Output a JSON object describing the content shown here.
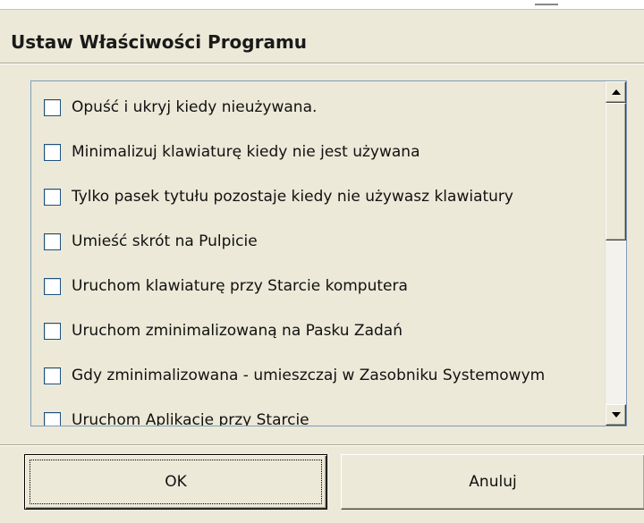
{
  "dialog": {
    "title": "Ustaw Właściwości Programu",
    "options": [
      {
        "label": "Opuść i ukryj kiedy nieużywana.",
        "checked": false
      },
      {
        "label": "Minimalizuj klawiaturę kiedy nie jest używana",
        "checked": false
      },
      {
        "label": "Tylko pasek tytułu pozostaje kiedy nie używasz klawiatury",
        "checked": false
      },
      {
        "label": "Umieść skrót na Pulpicie",
        "checked": false
      },
      {
        "label": "Uruchom klawiaturę przy Starcie komputera",
        "checked": false
      },
      {
        "label": "Uruchom zminimalizowaną na Pasku Zadań",
        "checked": false
      },
      {
        "label": "Gdy zminimalizowana - umieszczaj w Zasobniku Systemowym",
        "checked": false
      },
      {
        "label": "Uruchom Aplikacje przy Starcie",
        "checked": false
      }
    ],
    "buttons": {
      "ok_label": "OK",
      "cancel_label": "Anuluj"
    }
  },
  "icons": {
    "scroll_up": "arrow-up-icon",
    "scroll_down": "arrow-down-icon"
  },
  "colors": {
    "dialog_background": "#ece9d8",
    "checkbox_border": "#1c5180",
    "list_border": "#7f9db9"
  }
}
